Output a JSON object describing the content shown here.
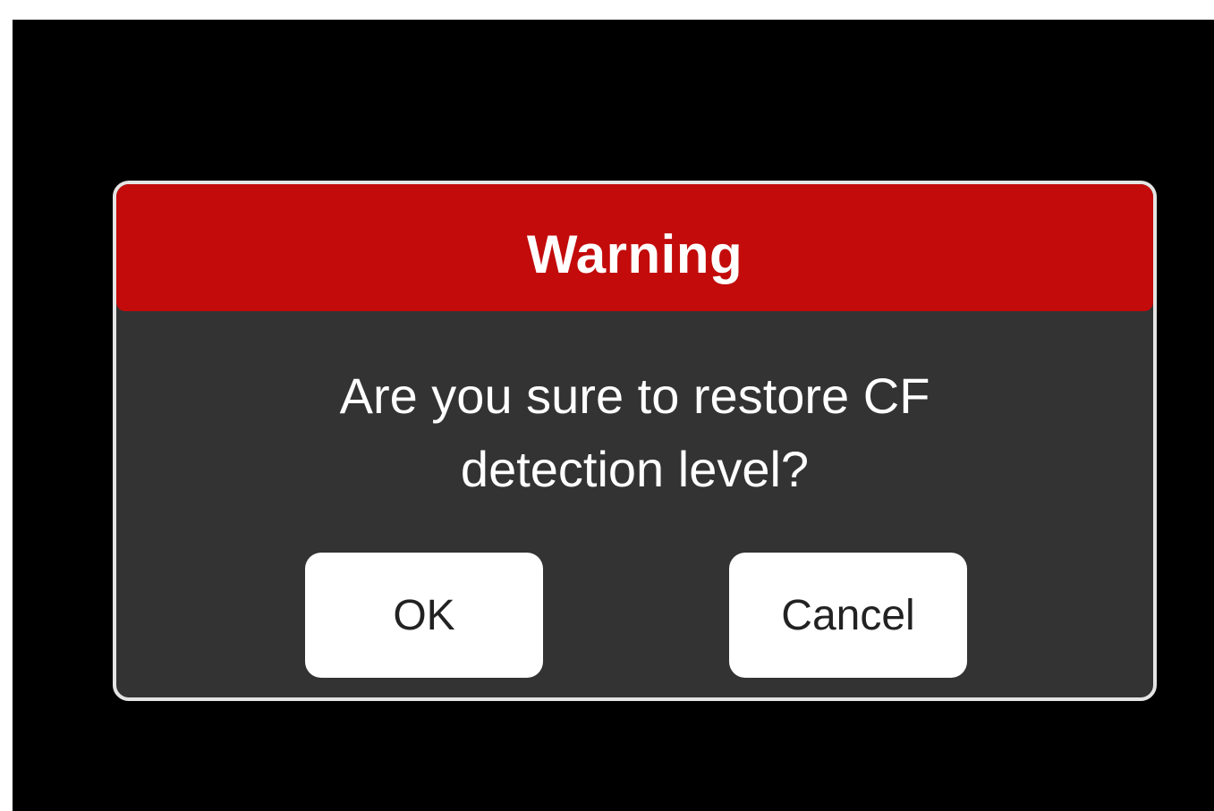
{
  "dialog": {
    "title": "Warning",
    "message_line1": "Are you sure to restore CF",
    "message_line2": "detection level?",
    "ok_label": "OK",
    "cancel_label": "Cancel"
  },
  "colors": {
    "header": "#c30b0b",
    "dialog_body": "#333333",
    "screen_background": "#000000",
    "button": "#ffffff"
  }
}
